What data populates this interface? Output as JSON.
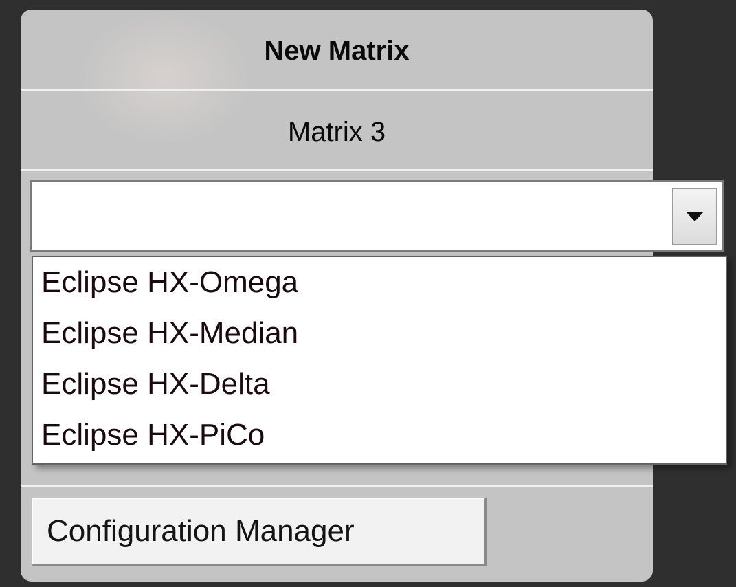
{
  "panel": {
    "title": "New Matrix",
    "subtitle": "Matrix 3"
  },
  "combo": {
    "value": "",
    "arrow_icon": "chevron-down-icon"
  },
  "dropdown": {
    "options": [
      "Eclipse HX-Omega",
      "Eclipse HX-Median",
      "Eclipse HX-Delta",
      "Eclipse HX-PiCo"
    ]
  },
  "footer": {
    "config_button_label": "Configuration Manager"
  }
}
